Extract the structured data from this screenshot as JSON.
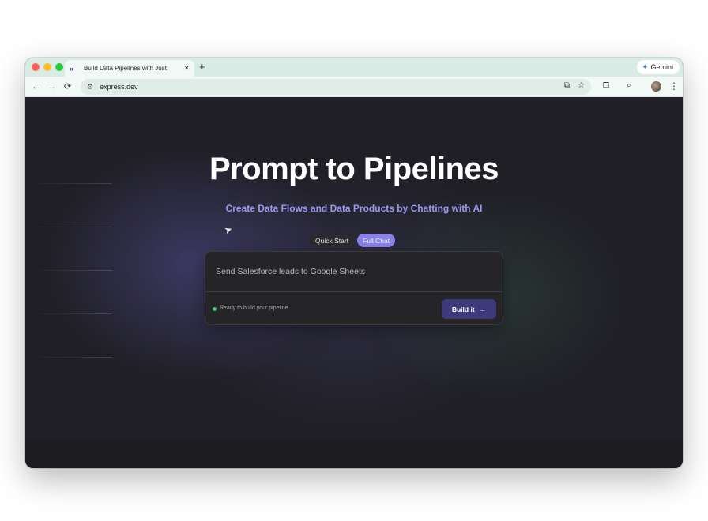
{
  "browser": {
    "tab_title": "Build Data Pipelines with Just",
    "tab_favicon": "»",
    "tab_close": "✕",
    "new_tab": "+",
    "gemini_label": "Gemini",
    "url": "express.dev",
    "icons": {
      "back": "back-arrow-icon",
      "forward": "forward-arrow-icon",
      "reload": "reload-icon",
      "site_info": "site-info-icon",
      "install": "install-app-icon",
      "bookmark": "star-icon",
      "extensions": "puzzle-icon",
      "tab_search": "tab-search-icon",
      "menu": "kebab-menu-icon"
    }
  },
  "hero": {
    "title": "Prompt to Pipelines",
    "subtitle": "Create Data Flows and Data Products by Chatting with AI"
  },
  "mode_tabs": {
    "quick_start": "Quick Start",
    "full_chat": "Full Chat",
    "selected": "Full Chat"
  },
  "chat": {
    "placeholder": "Send Salesforce leads to Google Sheets",
    "value": "",
    "status": "Ready to build your pipeline",
    "build_label": "Build it",
    "build_arrow": "→"
  },
  "colors": {
    "accent": "#8b82e8",
    "subtitle": "#9e95f0",
    "button": "#3d3a7a",
    "status_dot": "#3ec46d",
    "background": "#1f1f25"
  }
}
